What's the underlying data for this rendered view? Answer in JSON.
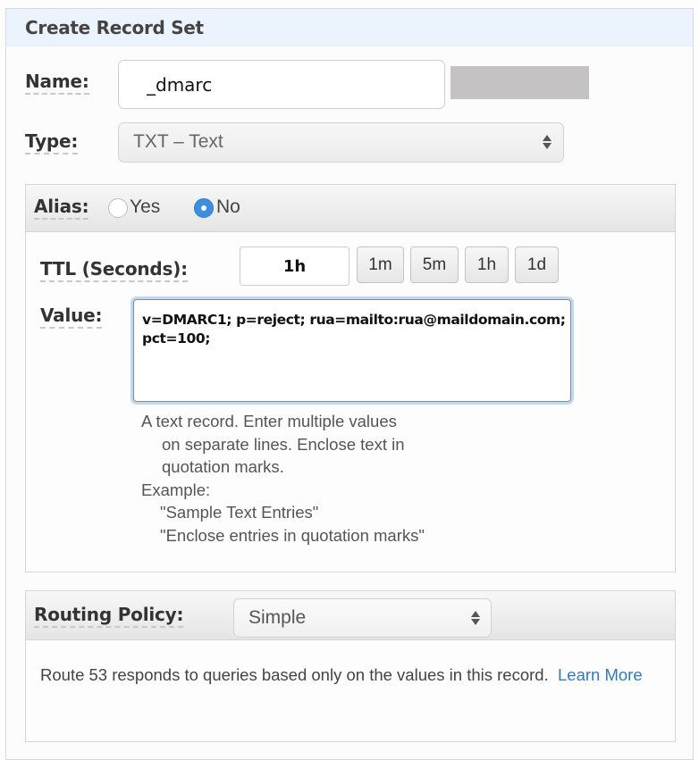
{
  "header": {
    "title": "Create Record Set"
  },
  "name_field": {
    "label": "Name:",
    "value": "_dmarc"
  },
  "type_field": {
    "label": "Type:",
    "selected": "TXT – Text"
  },
  "alias": {
    "label": "Alias:",
    "options": [
      {
        "label": "Yes",
        "checked": false
      },
      {
        "label": "No",
        "checked": true
      }
    ]
  },
  "ttl": {
    "label": "TTL (Seconds):",
    "value": "1h",
    "presets": [
      "1m",
      "5m",
      "1h",
      "1d"
    ]
  },
  "value_field": {
    "label": "Value:",
    "value": "v=DMARC1; p=reject; rua=mailto:rua@maildomain.com;\npct=100;"
  },
  "help": {
    "line1": "A text record. Enter multiple values",
    "line2": "on separate lines. Enclose text in",
    "line3": "quotation marks.",
    "line4": "Example:",
    "line5": "\"Sample Text Entries\"",
    "line6": "\"Enclose entries in quotation marks\""
  },
  "routing": {
    "label": "Routing Policy:",
    "selected": "Simple",
    "description": "Route 53 responds to queries based only on the values in this record.",
    "link_label_1": "Learn",
    "link_label_2": "More"
  },
  "colors": {
    "accent": "#3b8fe0",
    "link": "#2f7bc4",
    "header_bg": "#ebf3fc"
  }
}
